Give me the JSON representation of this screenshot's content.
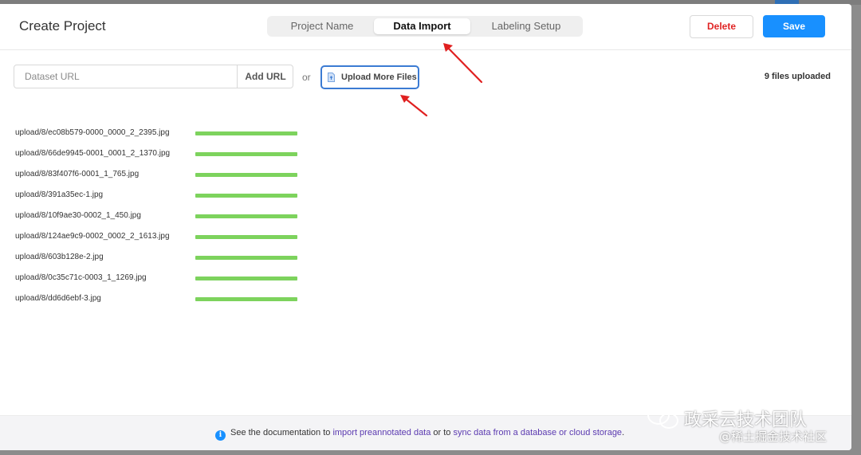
{
  "header": {
    "title": "Create Project",
    "tabs": [
      {
        "label": "Project Name",
        "active": false
      },
      {
        "label": "Data Import",
        "active": true
      },
      {
        "label": "Labeling Setup",
        "active": false
      }
    ],
    "delete_label": "Delete",
    "save_label": "Save"
  },
  "import": {
    "url_placeholder": "Dataset URL",
    "add_url_label": "Add URL",
    "or_label": "or",
    "upload_label": "Upload More Files",
    "files_uploaded": "9 files uploaded"
  },
  "files": [
    {
      "name": "upload/8/ec08b579-0000_0000_2_2395.jpg",
      "progress": 1.0
    },
    {
      "name": "upload/8/66de9945-0001_0001_2_1370.jpg",
      "progress": 1.0
    },
    {
      "name": "upload/8/83f407f6-0001_1_765.jpg",
      "progress": 1.0
    },
    {
      "name": "upload/8/391a35ec-1.jpg",
      "progress": 1.0
    },
    {
      "name": "upload/8/10f9ae30-0002_1_450.jpg",
      "progress": 1.0
    },
    {
      "name": "upload/8/124ae9c9-0002_0002_2_1613.jpg",
      "progress": 1.0
    },
    {
      "name": "upload/8/603b128e-2.jpg",
      "progress": 1.0
    },
    {
      "name": "upload/8/0c35c71c-0003_1_1269.jpg",
      "progress": 1.0
    },
    {
      "name": "upload/8/dd6d6ebf-3.jpg",
      "progress": 1.0
    }
  ],
  "footer": {
    "info_icon": "i",
    "text_1": "See the documentation to ",
    "link_1": "import preannotated data",
    "text_2": " or to ",
    "link_2": "sync data from a database or cloud storage",
    "text_3": "."
  },
  "watermark": {
    "line1": "政采云技术团队",
    "line2": "@稀土掘金技术社区"
  },
  "colors": {
    "primary": "#1890ff",
    "danger": "#e02424",
    "progress": "#7dd35d",
    "link": "#5b3ab0",
    "annotation_arrow": "#e02020"
  }
}
